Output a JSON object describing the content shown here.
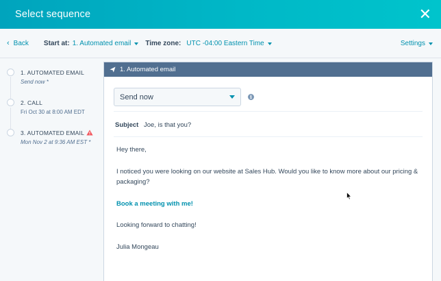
{
  "header": {
    "title": "Select sequence",
    "close_icon": "close-icon"
  },
  "toolbar": {
    "back_label": "Back",
    "start_at_label": "Start at:",
    "start_at_value": "1. Automated email",
    "timezone_label": "Time zone:",
    "timezone_value": "UTC -04:00 Eastern Time",
    "settings_label": "Settings"
  },
  "steps": [
    {
      "title": "1. AUTOMATED EMAIL",
      "subtitle": "Send now *"
    },
    {
      "title": "2. CALL",
      "subtitle": "Fri Oct 30 at 8:00 AM EDT"
    },
    {
      "title": "3. AUTOMATED EMAIL",
      "subtitle": "Mon Nov 2 at 9:36 AM EST *",
      "warning": true
    }
  ],
  "card": {
    "title": "1. Automated email",
    "send_select_value": "Send now",
    "subject_label": "Subject",
    "subject_value": "Joe, is that you?",
    "body": {
      "greeting": "Hey there,",
      "paragraph": "I noticed you were looking on our website at Sales Hub. Would you like to know more about our pricing & packaging?",
      "link_text": "Book a meeting with me!",
      "closing": "Looking forward to chatting!",
      "signature": "Julia Mongeau"
    }
  },
  "colors": {
    "header_start": "#00a4bd",
    "header_end": "#00c4cc",
    "link": "#0091ae",
    "card_header": "#516f90",
    "warning": "#f2545b"
  }
}
